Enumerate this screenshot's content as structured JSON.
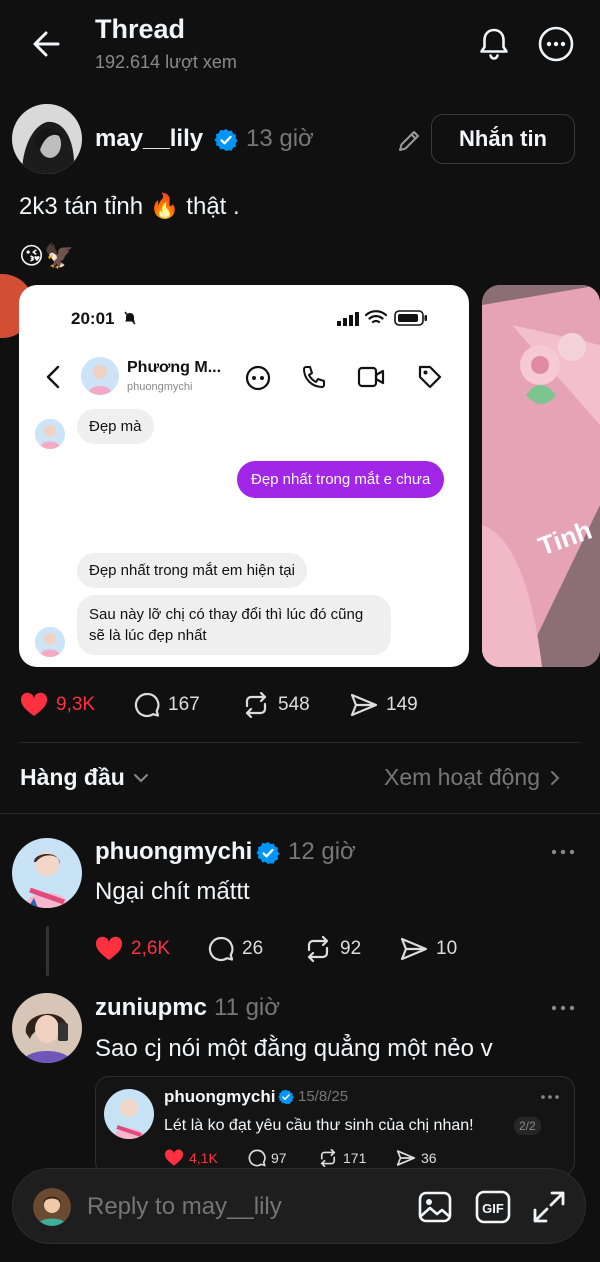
{
  "header": {
    "title": "Thread",
    "subtitle": "192.614 lượt xem"
  },
  "post": {
    "username": "may__lily",
    "time": "13 giờ",
    "message_button": "Nhắn tin",
    "text": "2k3 tán tỉnh 🔥 thật .",
    "emoji_line": "😘🦅",
    "likes": "9,3K",
    "comments": "167",
    "reposts": "548",
    "shares": "149"
  },
  "screenshot": {
    "time": "20:01",
    "contact_name": "Phương M...",
    "contact_handle": "phuongmychi",
    "messages": [
      {
        "side": "left",
        "text": "Đẹp mà"
      },
      {
        "side": "right",
        "text": "Đẹp nhất trong mắt e chưa"
      },
      {
        "side": "left",
        "text": "Đẹp nhất trong mắt em hiện tại"
      },
      {
        "side": "left",
        "text": "Sau này lỡ chị có thay đổi thì lúc đó cũng sẽ là lúc đẹp nhất"
      }
    ]
  },
  "second_image": {
    "visible_text": "Tinh"
  },
  "sort": {
    "label": "Hàng đầu",
    "activity_link": "Xem hoạt động"
  },
  "comments": [
    {
      "username": "phuongmychi",
      "time": "12 giờ",
      "text": "Ngại chít mấttt",
      "likes": "2,6K",
      "comments": "26",
      "reposts": "92",
      "shares": "10"
    },
    {
      "username": "zuniupmc",
      "time": "11 giờ",
      "text": "Sao cj nói một đằng quẳng một nẻo v",
      "quoted": {
        "username": "phuongmychi",
        "date": "15/8/25",
        "text": "Lét là ko đạt yêu cầu thư sinh của chị nhan!",
        "page": "2/2",
        "likes": "4,1K",
        "comments": "97",
        "reposts": "171",
        "shares": "36"
      }
    }
  ],
  "reply": {
    "placeholder": "Reply to may__lily"
  },
  "colors": {
    "background": "#101010",
    "like_red": "#ff3040",
    "verified_blue": "#0095f6",
    "bubble_purple": "#a126e8"
  }
}
